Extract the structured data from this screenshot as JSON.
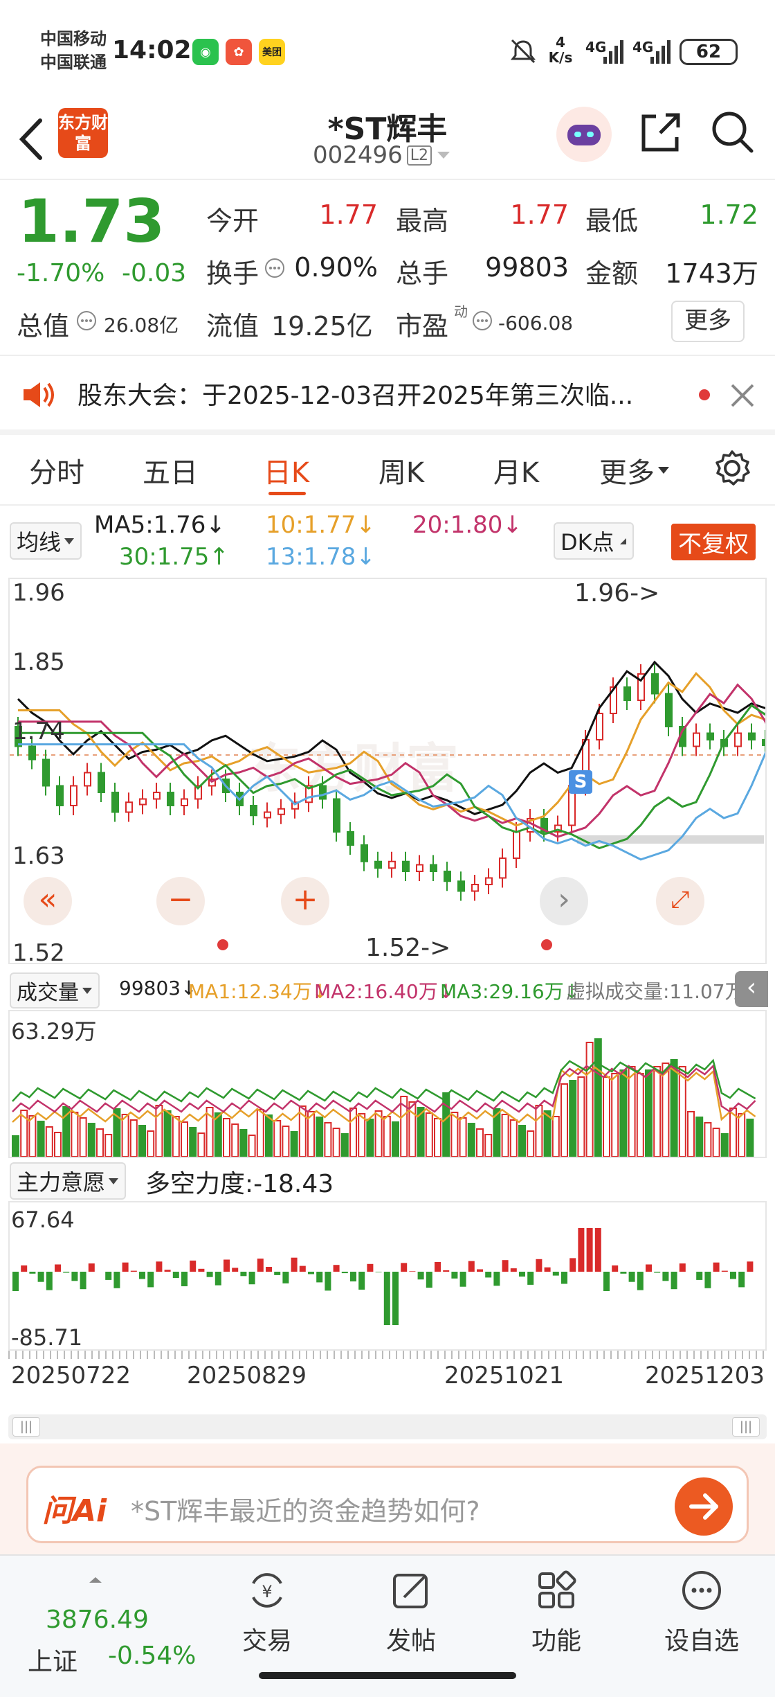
{
  "status": {
    "carrier1": "中国移动",
    "carrier2": "中国联通",
    "time": "14:02",
    "app_icons": [
      "wechat-icon",
      "app-icon",
      "meituan-icon"
    ],
    "meituan": "美团",
    "net_speed_value": "4",
    "net_speed_unit": "K/s",
    "signal1": "4G",
    "signal2": "4G",
    "battery": "62"
  },
  "header": {
    "logo": "东方财富",
    "stock_name": "*ST辉丰",
    "stock_code": "002496",
    "level": "L2"
  },
  "quote": {
    "price": "1.73",
    "change_pct": "-1.70%",
    "change": "-0.03",
    "rows": [
      [
        {
          "label": "今开",
          "value": "1.77",
          "color": "#d92a2a"
        },
        {
          "label": "最高",
          "value": "1.77",
          "color": "#d92a2a"
        },
        {
          "label": "最低",
          "value": "1.72",
          "color": "#2f9a2f"
        }
      ],
      [
        {
          "label": "换手",
          "value": "0.90%",
          "color": "#222222"
        },
        {
          "label": "总手",
          "value": "99803",
          "color": "#222222"
        },
        {
          "label": "金额",
          "value": "1743万",
          "color": "#222222"
        }
      ]
    ],
    "total_value_label": "总值",
    "total_value": "26.08亿",
    "float_value_label": "流值",
    "float_value": "19.25亿",
    "pe_label": "市盈",
    "pe_sup": "动",
    "pe_value": "-606.08",
    "more": "更多"
  },
  "notice": {
    "text": "股东大会：于2025-12-03召开2025年第三次临..."
  },
  "tabs": [
    "分时",
    "五日",
    "日K",
    "周K",
    "月K",
    "更多"
  ],
  "active_tab": 2,
  "ma": {
    "selector": "均线",
    "ma5": "MA5:1.76↓",
    "ma10": "10:1.77↓",
    "ma20": "20:1.80↓",
    "ma30": "30:1.75↑",
    "ma13": "13:1.78↓",
    "dk": "DK点",
    "adjust": "不复权"
  },
  "kchart": {
    "y_top": "1.96",
    "y_2": "1.85",
    "y_3": "1.74",
    "y_4": "1.63",
    "y_bottom": "1.52",
    "high_mark": "1.96->",
    "low_mark": "1.52->",
    "watermark": "东方财富",
    "s_badge": "S"
  },
  "volume": {
    "selector": "成交量",
    "value": "99803↓",
    "ma1": "MA1:12.34万↓",
    "ma2": "MA2:16.40万↓",
    "ma3": "MA3:29.16万↓",
    "virtual": "虚拟成交量:11.07万",
    "top": "63.29万"
  },
  "force": {
    "selector": "主力意愿",
    "label": "多空力度:-18.43",
    "top": "67.64",
    "bottom": "-85.71"
  },
  "dates": [
    "20250722",
    "20250829",
    "20251021",
    "20251203"
  ],
  "ai": {
    "logo": "问Ai",
    "prompt": "*ST辉丰最近的资金趋势如何?"
  },
  "bottom_nav": {
    "index_value": "3876.49",
    "index_name": "上证",
    "index_change": "-0.54%",
    "items": [
      "交易",
      "发帖",
      "功能",
      "设自选"
    ]
  },
  "colors": {
    "up": "#d92a2a",
    "down": "#2f9a2f",
    "accent": "#e64a19"
  }
}
